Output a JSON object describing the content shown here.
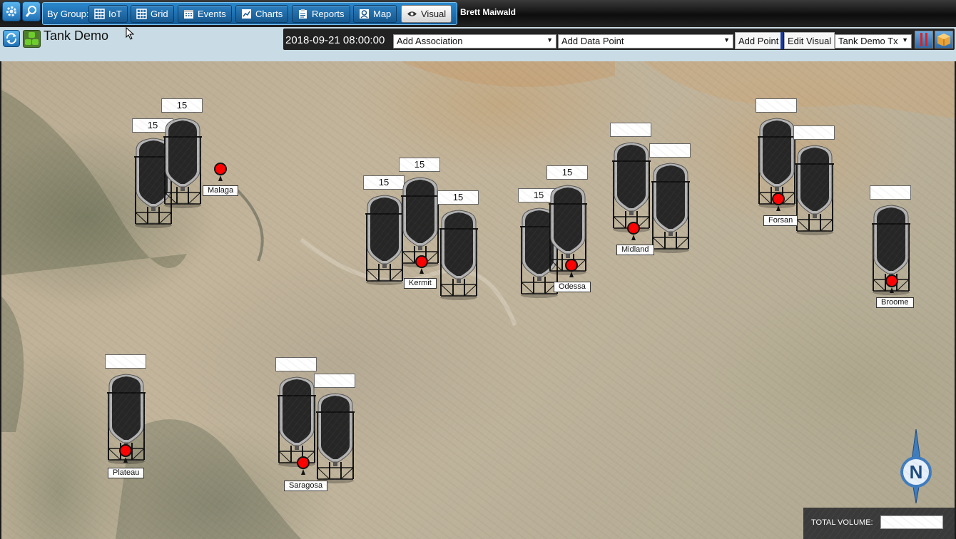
{
  "toolbar": {
    "group_label": "By Group:",
    "buttons": [
      {
        "label": "IoT",
        "icon": "iot-grid-icon"
      },
      {
        "label": "Grid",
        "icon": "grid-icon"
      },
      {
        "label": "Events",
        "icon": "calendar-icon"
      },
      {
        "label": "Charts",
        "icon": "line-chart-icon"
      },
      {
        "label": "Reports",
        "icon": "clipboard-icon"
      },
      {
        "label": "Map",
        "icon": "map-pin-icon"
      },
      {
        "label": "Visual",
        "icon": "eye-icon",
        "active": true
      }
    ],
    "user": "Brett Maiwald"
  },
  "header": {
    "title": "Tank Demo",
    "datetime": "2018-09-21 08:00:00",
    "association_select": "Add Association",
    "datapoint_select": "Add Data Point",
    "add_point": "Add Point",
    "edit_visual": "Edit Visual",
    "visual_select": "Tank Demo Tx"
  },
  "map": {
    "locations": [
      {
        "label": "Malaga",
        "tank_values": [
          "15",
          "15"
        ]
      },
      {
        "label": "Kermit",
        "tank_values": [
          "15",
          "15",
          "15"
        ]
      },
      {
        "label": "Odessa",
        "tank_values": [
          "15",
          "15"
        ]
      },
      {
        "label": "Midland",
        "tank_values": [
          "",
          ""
        ]
      },
      {
        "label": "Forsan",
        "tank_values": [
          "",
          ""
        ]
      },
      {
        "label": "Broome",
        "tank_values": [
          ""
        ]
      },
      {
        "label": "Plateau",
        "tank_values": [
          ""
        ]
      },
      {
        "label": "Saragosa",
        "tank_values": [
          "",
          ""
        ]
      }
    ],
    "compass_label": "N",
    "total_volume_label": "TOTAL VOLUME:",
    "total_volume_value": ""
  },
  "colors": {
    "toolbar_blue": "#1f6fb3",
    "marker_red": "#ff0000",
    "tank_dark": "#222222",
    "tank_silver": "#a8a8a8"
  }
}
